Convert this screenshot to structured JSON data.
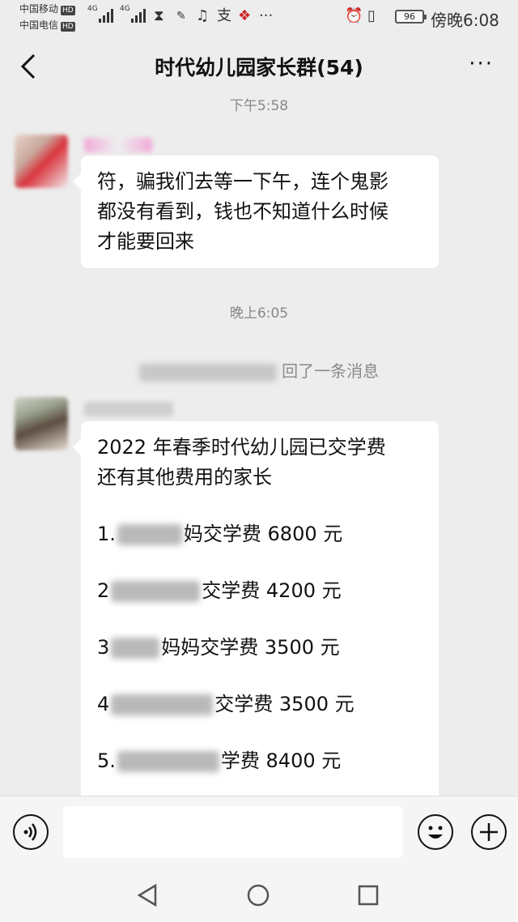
{
  "status_bar": {
    "carrier_1": "中国移动",
    "carrier_2": "中国电信",
    "hd_badge": "HD",
    "net_1": "4G",
    "net_2": "4G",
    "battery": "96",
    "time": "傍晚6:08"
  },
  "header": {
    "title": "时代幼儿园家长群(54)",
    "more": "···"
  },
  "chat": {
    "timestamp_1": "下午5:58",
    "message_1": {
      "lines": [
        "符，骗我们去等一下午，连个鬼影",
        "都没有看到，钱也不知道什么时候",
        "才能要回来"
      ]
    },
    "timestamp_2": "晚上6:05",
    "system_notice": "回了一条消息",
    "message_2": {
      "intro_lines": [
        "2022 年春季时代幼儿园已交学费",
        "还有其他费用的家长"
      ],
      "fees": [
        {
          "prefix": "1.",
          "suffix": "妈交学费 6800 元"
        },
        {
          "prefix": "2",
          "suffix": "交学费 4200 元"
        },
        {
          "prefix": "3",
          "suffix": "妈妈交学费 3500 元"
        },
        {
          "prefix": "4",
          "suffix": "交学费 3500 元"
        },
        {
          "prefix": "5.",
          "suffix": "学费 8400 元"
        }
      ]
    }
  },
  "input": {
    "placeholder": ""
  }
}
